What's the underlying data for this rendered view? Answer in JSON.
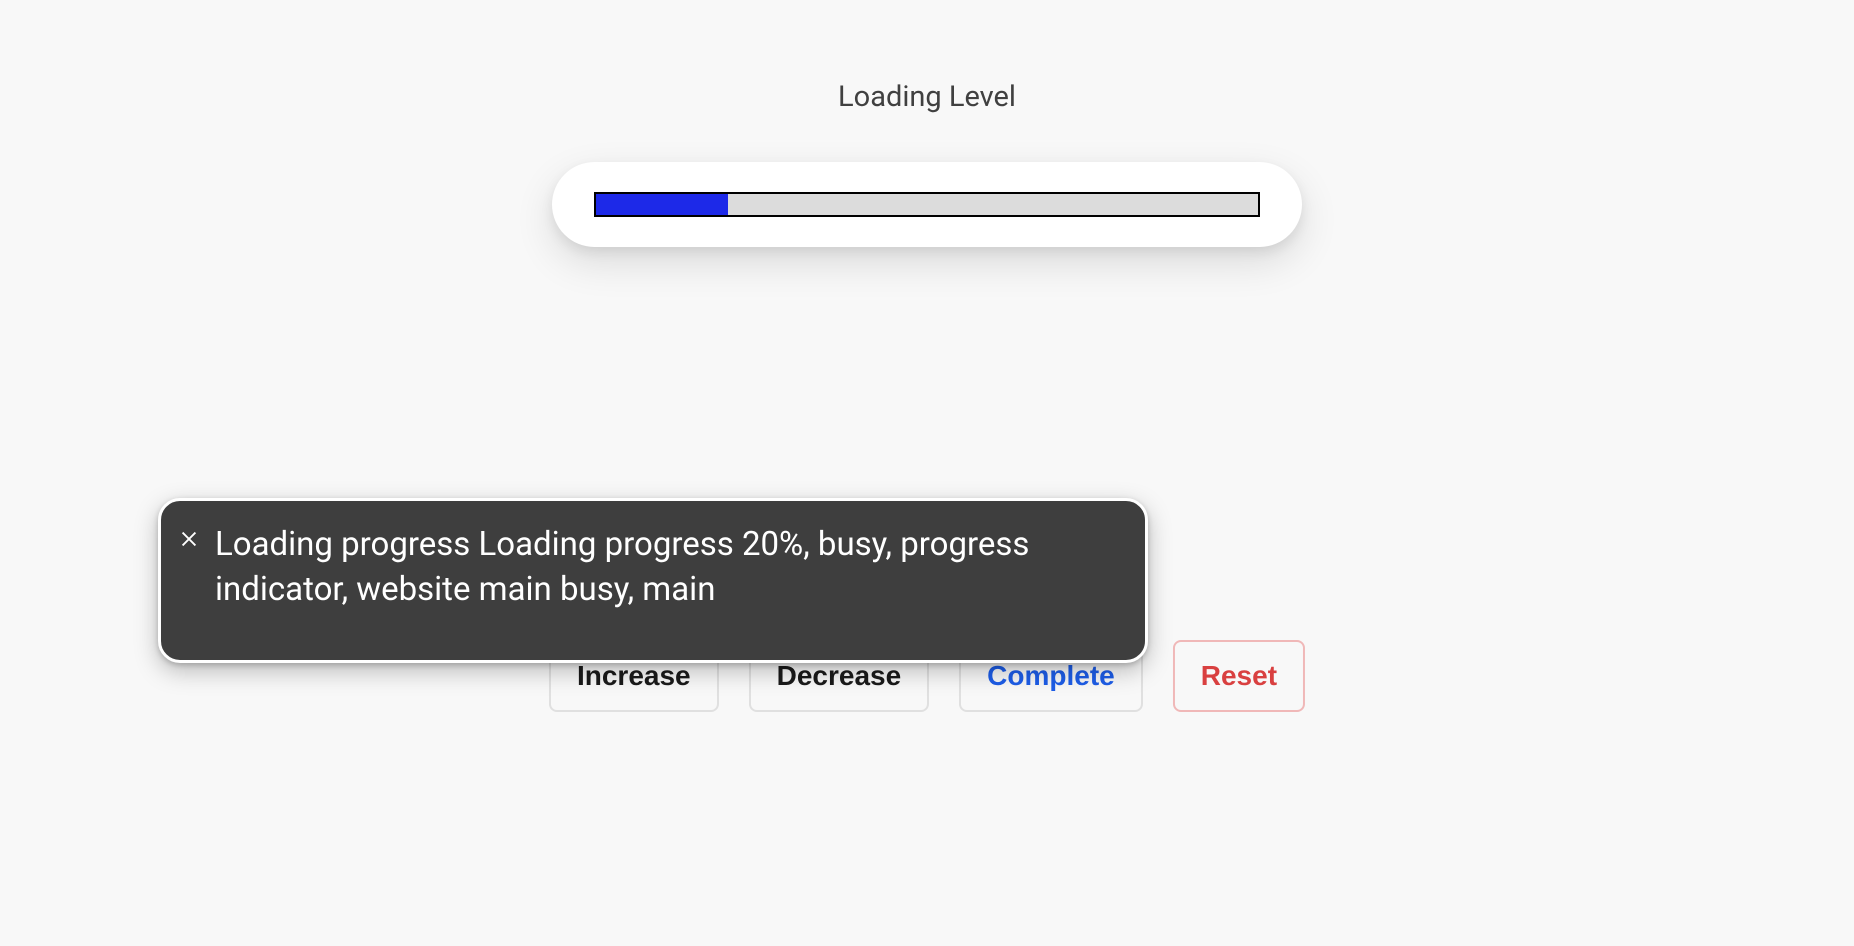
{
  "title": "Loading Level",
  "progress": {
    "percent": 20
  },
  "buttons": {
    "increase": "Increase",
    "decrease": "Decrease",
    "complete": "Complete",
    "reset": "Reset"
  },
  "tooltip": {
    "text": "Loading progress Loading progress 20%, busy, progress indicator, website main busy, main"
  }
}
